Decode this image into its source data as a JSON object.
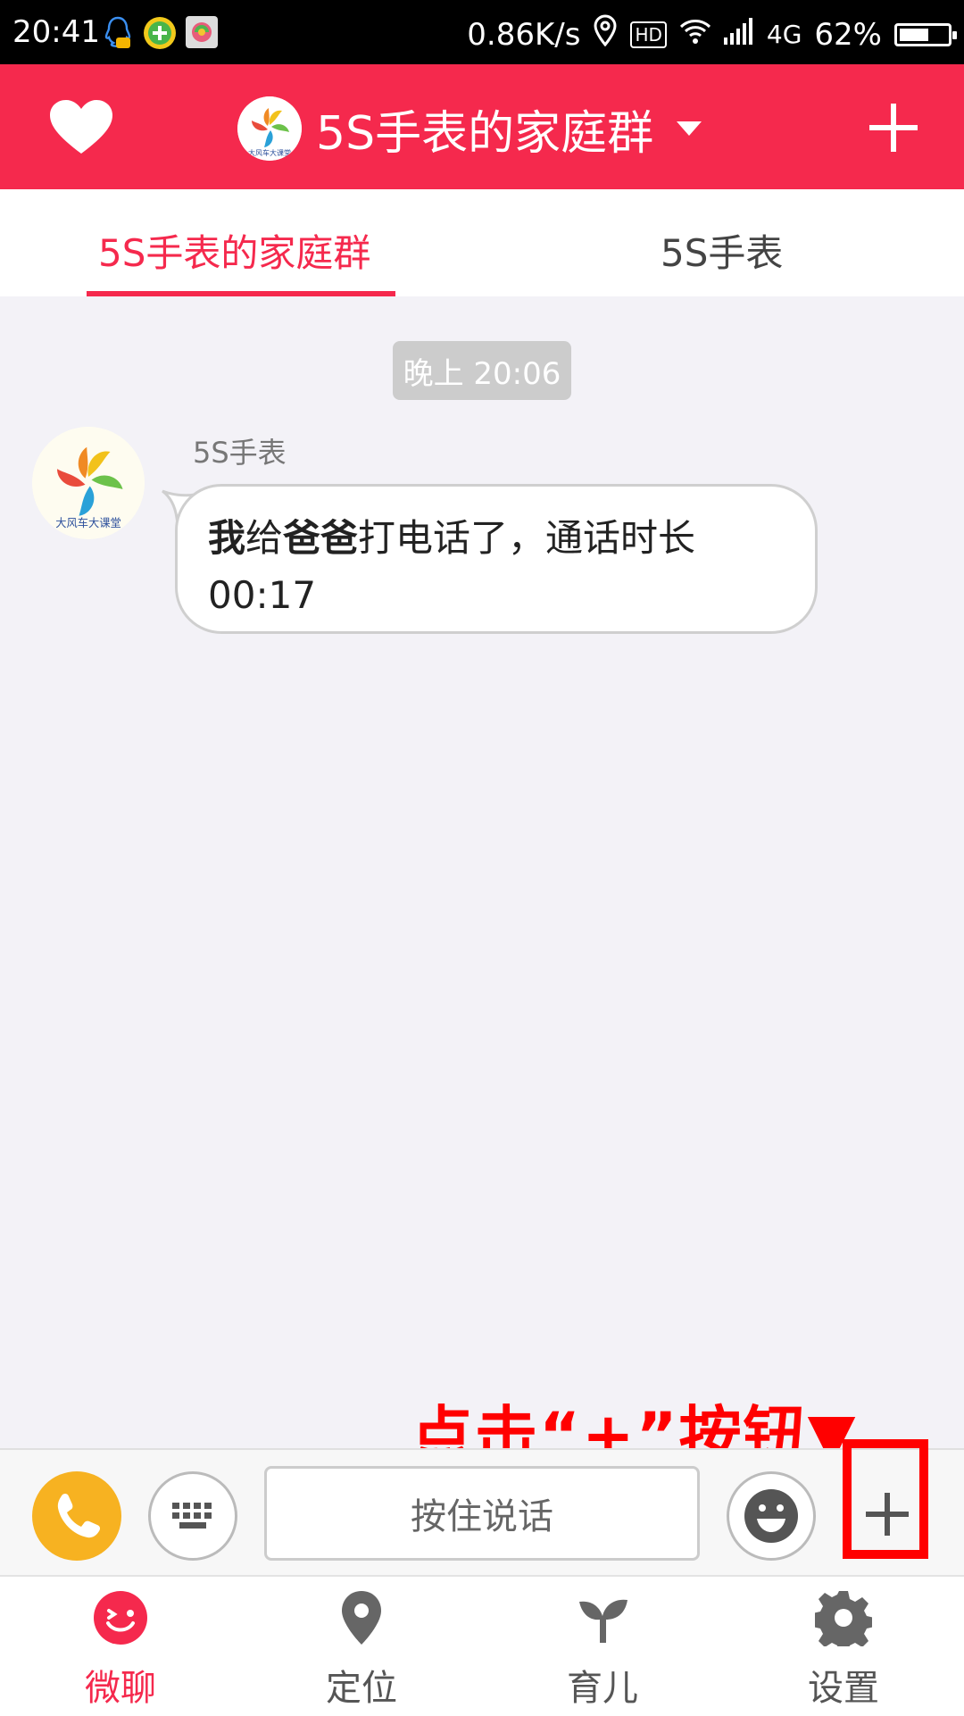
{
  "status_bar": {
    "time": "20:41",
    "net_speed": "0.86K/s",
    "hd": "HD",
    "network": "4G",
    "battery": "62%",
    "battery_level": 0.62,
    "icons": [
      "qq-icon",
      "plus-circle-icon",
      "app-icon",
      "location-icon",
      "hd-icon",
      "wifi-icon",
      "signal-icon",
      "battery-icon"
    ]
  },
  "header": {
    "title": "5S手表的家庭群",
    "left_icon": "heart-icon",
    "right_icon": "plus-icon",
    "dropdown_icon": "caret-down-icon"
  },
  "tabs": [
    {
      "label": "5S手表的家庭群",
      "active": true
    },
    {
      "label": "5S手表",
      "active": false
    }
  ],
  "chat": {
    "timestamp": "晚上 20:06",
    "messages": [
      {
        "sender": "5S手表",
        "avatar": "pinwheel-avatar",
        "text_parts": [
          {
            "t": "我",
            "bold": true
          },
          {
            "t": "给",
            "bold": false
          },
          {
            "t": "爸爸",
            "bold": true
          },
          {
            "t": "打电话了，通话时长  00:17",
            "bold": false
          }
        ]
      }
    ]
  },
  "annotation": {
    "text": "点击“+”按钮▼",
    "color": "#ff0000"
  },
  "input_bar": {
    "voice_label": "按住说话",
    "call_icon": "phone-icon",
    "keyboard_icon": "keyboard-icon",
    "emoji_icon": "smiley-icon",
    "more_icon": "plus-icon"
  },
  "bottom_nav": [
    {
      "label": "微聊",
      "icon": "chat-smile-icon",
      "active": true
    },
    {
      "label": "定位",
      "icon": "map-pin-icon",
      "active": false
    },
    {
      "label": "育儿",
      "icon": "sprout-icon",
      "active": false
    },
    {
      "label": "设置",
      "icon": "gear-icon",
      "active": false
    }
  ],
  "colors": {
    "brand": "#f5294d",
    "call": "#f7b221",
    "annotation": "#ff0000"
  }
}
